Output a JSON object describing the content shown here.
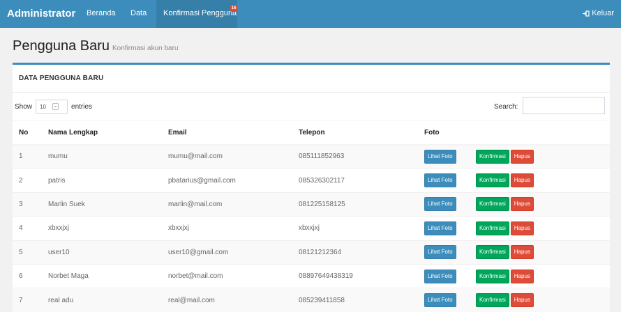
{
  "navbar": {
    "brand": "Administrator",
    "links": [
      "Beranda",
      "Data",
      "Konfirmasi Pengguna"
    ],
    "badge": "16",
    "logout": "Keluar"
  },
  "page": {
    "title": "Pengguna Baru",
    "subtitle": "Konfirmasi akun baru"
  },
  "box": {
    "title": "DATA PENGGUNA BARU"
  },
  "controls": {
    "show_label": "Show",
    "entries_value": "10",
    "entries_label": "entries",
    "search_label": "Search:",
    "search_value": ""
  },
  "table": {
    "columns": [
      "No",
      "Nama Lengkap",
      "Email",
      "Telepon",
      "Foto",
      ""
    ],
    "rows": [
      {
        "no": "1",
        "name": "mumu",
        "email": "mumu@mail.com",
        "phone": "085111852963"
      },
      {
        "no": "2",
        "name": "patris",
        "email": "pbatarius@gmail.com",
        "phone": "085326302117"
      },
      {
        "no": "3",
        "name": "Marlin Suek",
        "email": "marlin@mail.com",
        "phone": "081225158125"
      },
      {
        "no": "4",
        "name": "xbxxjxj",
        "email": "xbxxjxj",
        "phone": "xbxxjxj"
      },
      {
        "no": "5",
        "name": "user10",
        "email": "user10@gmail.com",
        "phone": "08121212364"
      },
      {
        "no": "6",
        "name": "Norbet Maga",
        "email": "norbet@mail.com",
        "phone": "08897649438319"
      },
      {
        "no": "7",
        "name": "real adu",
        "email": "real@mail.com",
        "phone": "085239411858"
      }
    ],
    "buttons": {
      "view_photo": "Lihat Foto",
      "confirm": "Konfirmasi",
      "delete": "Hapus"
    }
  },
  "colors": {
    "primary": "#3c8dbc",
    "success": "#00a65a",
    "danger": "#dd4b39"
  }
}
